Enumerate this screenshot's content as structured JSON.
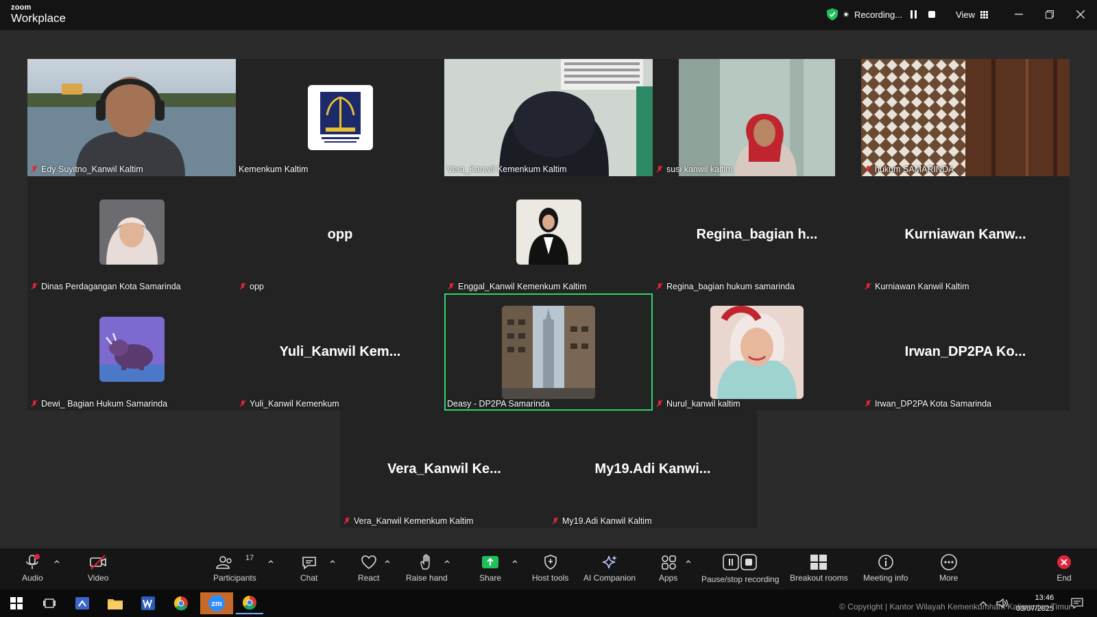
{
  "app": {
    "brand_top": "zoom",
    "brand_bottom": "Workplace"
  },
  "recording": {
    "label": "Recording...",
    "view_label": "View"
  },
  "participants_grid": [
    {
      "name": "Edy Suyitno_Kanwil Kaltim",
      "display": "video",
      "muted": true
    },
    {
      "name": "Kemenkum Kaltim",
      "display": "logo",
      "muted": false
    },
    {
      "name": "Vera_Kanwil Kemenkum Kaltim",
      "display": "video",
      "muted": false
    },
    {
      "name": "susi kanwil kaltim",
      "display": "video",
      "muted": true
    },
    {
      "name": "hukum SAMARINDA",
      "display": "video",
      "muted": true
    },
    {
      "name": "Dinas Perdagangan Kota Samarinda",
      "display": "avatar",
      "muted": true
    },
    {
      "name": "opp",
      "display": "name",
      "big": "opp",
      "muted": true
    },
    {
      "name": "Enggal_Kanwil Kemenkum Kaltim",
      "display": "avatar",
      "muted": true
    },
    {
      "name": "Regina_bagian hukum samarinda",
      "display": "name",
      "big": "Regina_bagian  h...",
      "muted": true
    },
    {
      "name": "Kurniawan Kanwil Kaltim",
      "display": "name",
      "big": "Kurniawan  Kanw...",
      "muted": true
    },
    {
      "name": "Dewi_ Bagian Hukum Samarinda",
      "display": "avatar",
      "muted": true
    },
    {
      "name": "Yuli_Kanwil Kemenkum",
      "display": "name",
      "big": "Yuli_Kanwil  Kem...",
      "muted": true
    },
    {
      "name": "Deasy - DP2PA Samarinda",
      "display": "avatar-large",
      "muted": false,
      "active": true
    },
    {
      "name": "Nurul_kanwil kaltim",
      "display": "avatar-large",
      "muted": true
    },
    {
      "name": "Irwan_DP2PA Kota Samarinda",
      "display": "name",
      "big": "Irwan_DP2PA  Ko...",
      "muted": true
    },
    {
      "name": "Vera_Kanwil Kemenkum Kaltim",
      "display": "name",
      "big": "Vera_Kanwil  Ke...",
      "muted": true
    },
    {
      "name": "My19.Adi Kanwil Kaltim",
      "display": "name",
      "big": "My19.Adi  Kanwi...",
      "muted": true
    }
  ],
  "toolbar": {
    "audio": "Audio",
    "video": "Video",
    "participants": "Participants",
    "participants_count": "17",
    "chat": "Chat",
    "react": "React",
    "raise_hand": "Raise hand",
    "share": "Share",
    "host_tools": "Host tools",
    "ai_companion": "AI Companion",
    "apps": "Apps",
    "pause_stop_recording": "Pause/stop recording",
    "breakout_rooms": "Breakout rooms",
    "meeting_info": "Meeting info",
    "more": "More",
    "end": "End"
  },
  "taskbar": {
    "copyright": "© Copyright | Kantor Wilayah Kemenkumham Kalimantan Timur",
    "time": "13:46",
    "date": "03/07/2025"
  },
  "colors": {
    "accent_green": "#2bd56b",
    "recording_red": "#e0243b",
    "share_green": "#1fbf5a"
  }
}
